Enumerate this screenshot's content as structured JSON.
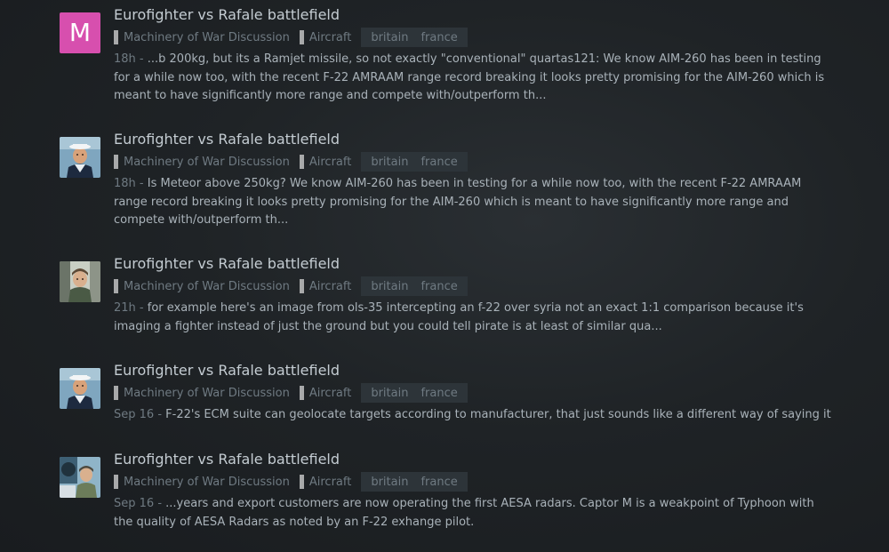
{
  "results": [
    {
      "avatar_type": "letter",
      "avatar_letter": "M",
      "avatar_color": "#d74fae",
      "title": "Eurofighter vs Rafale battlefield",
      "category": "Machinery of War Discussion",
      "subcategory": "Aircraft",
      "tags": [
        "britain",
        "france"
      ],
      "date": "18h",
      "separator": " - ",
      "blurb": "...b 200kg, but its a Ramjet missile, so not exactly \"conventional\" quartas121: We know AIM-260 has been in testing for a while now too, with the recent F-22 AMRAAM range record breaking it looks pretty promising for the AIM-260 which is meant to have significantly more range and compete with/outperform th..."
    },
    {
      "avatar_type": "image",
      "avatar_icon": "sailor-avatar-icon",
      "title": "Eurofighter vs Rafale battlefield",
      "category": "Machinery of War Discussion",
      "subcategory": "Aircraft",
      "tags": [
        "britain",
        "france"
      ],
      "date": "18h",
      "separator": " - ",
      "blurb": "Is Meteor above 250kg? We know AIM-260 has been in testing for a while now too, with the recent F-22 AMRAAM range record breaking it looks pretty promising for the AIM-260 which is meant to have significantly more range and compete with/outperform th..."
    },
    {
      "avatar_type": "image",
      "avatar_icon": "pilot-cockpit-avatar-icon",
      "title": "Eurofighter vs Rafale battlefield",
      "category": "Machinery of War Discussion",
      "subcategory": "Aircraft",
      "tags": [
        "britain",
        "france"
      ],
      "date": "21h",
      "separator": " - ",
      "blurb": "for example here's an image from ols-35 intercepting an f-22 over syria not an exact 1:1 comparison because it's imaging a fighter instead of just the ground but you could tell pirate is at least of similar qua..."
    },
    {
      "avatar_type": "image",
      "avatar_icon": "sailor-avatar-icon",
      "title": "Eurofighter vs Rafale battlefield",
      "category": "Machinery of War Discussion",
      "subcategory": "Aircraft",
      "tags": [
        "britain",
        "france"
      ],
      "date": "Sep 16",
      "separator": " - ",
      "blurb": "F-22's ECM suite can geolocate targets according to manufacturer, that just sounds like a different way of saying it"
    },
    {
      "avatar_type": "image",
      "avatar_icon": "pilot-jet-avatar-icon",
      "title": "Eurofighter vs Rafale battlefield",
      "category": "Machinery of War Discussion",
      "subcategory": "Aircraft",
      "tags": [
        "britain",
        "france"
      ],
      "date": "Sep 16",
      "separator": " - ",
      "blurb": "...years and export customers are now operating the first AESA radars. Captor M is a weakpoint of Typhoon with the quality of AESA Radars as noted by an F-22 exhange pilot."
    }
  ]
}
